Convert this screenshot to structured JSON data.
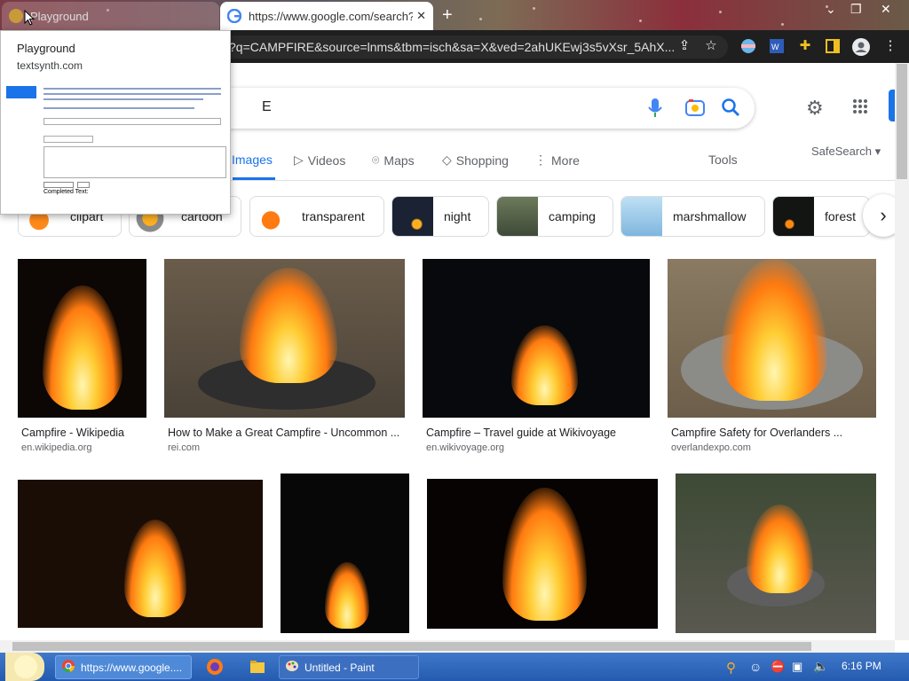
{
  "browser": {
    "tabs": [
      {
        "title": "Playground",
        "active": false
      },
      {
        "title": "https://www.google.com/search?",
        "active": true
      }
    ],
    "address": "?q=CAMPFIRE&source=lnms&tbm=isch&sa=X&ved=2ahUKEwj3s5vXsr_5AhX..."
  },
  "tab_hover": {
    "title": "Playground",
    "domain": "textsynth.com",
    "preview_label": "Completed Text:"
  },
  "search": {
    "query_fragment": "E"
  },
  "nav_tabs": [
    {
      "label": "Images",
      "active": true,
      "icon": "none"
    },
    {
      "label": "Videos",
      "active": false,
      "icon": "video-icon"
    },
    {
      "label": "Maps",
      "active": false,
      "icon": "map-pin-icon"
    },
    {
      "label": "Shopping",
      "active": false,
      "icon": "tag-icon"
    },
    {
      "label": "More",
      "active": false,
      "icon": "more-vert-icon"
    }
  ],
  "tools_label": "Tools",
  "safesearch_label": "SafeSearch",
  "chips": [
    "clipart",
    "cartoon",
    "transparent",
    "night",
    "camping",
    "marshmallow",
    "forest"
  ],
  "results": [
    {
      "title": "Campfire - Wikipedia",
      "source": "en.wikipedia.org"
    },
    {
      "title": "How to Make a Great Campfire - Uncommon ...",
      "source": "rei.com"
    },
    {
      "title": "Campfire – Travel guide at Wikivoyage",
      "source": "en.wikivoyage.org"
    },
    {
      "title": "Campfire Safety for Overlanders ...",
      "source": "overlandexpo.com"
    }
  ],
  "taskbar": {
    "items": [
      {
        "label": "https://www.google...."
      },
      {
        "label": "Untitled - Paint"
      }
    ],
    "clock": "6:16 PM"
  },
  "colors": {
    "accent": "#1a73e8",
    "toolbar": "#1f1f1f",
    "taskbar": "#245bb0"
  }
}
